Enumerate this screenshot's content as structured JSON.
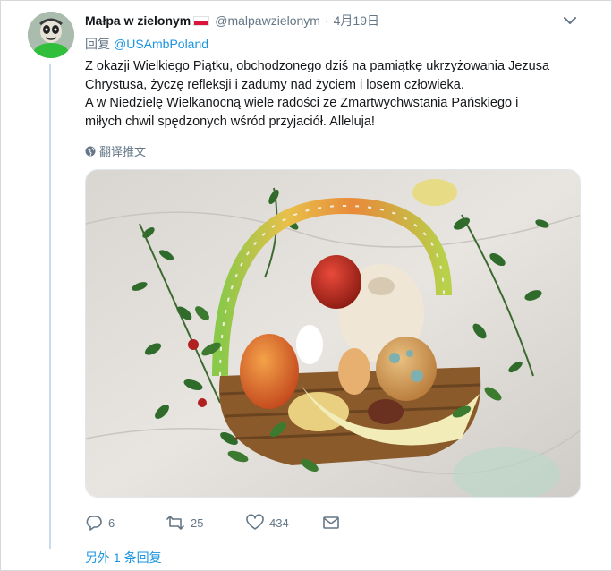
{
  "tweet": {
    "author_name": "Małpa w zielonym",
    "flag": "Poland flag",
    "handle": "@malpawzielonym",
    "separator": "·",
    "date": "4月19日",
    "reply_prefix": "回复",
    "reply_to": "@USAmbPoland",
    "text_lines": [
      "Z okazji Wielkiego Piątku, obchodzonego dziś na pamiątkę ukrzyżowania Jezusa",
      "Chrystusa, życzę refleksji i zadumy nad życiem i losem człowieka.",
      "A w Niedzielę Wielkanocną wiele radości ze Zmartwychwstania Pańskiego i",
      "miłych chwil spędzonych wśród przyjaciół. Alleluja!"
    ],
    "translate_label": "翻译推文",
    "image_description": "Easter basket with eggs, cake and boxwood",
    "actions": {
      "replies": "6",
      "retweets": "25",
      "likes": "434"
    },
    "more_replies": "另外 1 条回复"
  },
  "colors": {
    "link": "#1b95e0",
    "secondary_text": "#657786",
    "thread_line": "#c7dcec",
    "flag_red": "#dc143c"
  },
  "icons": {
    "chevron": "chevron-down-icon",
    "globe": "globe-icon",
    "reply": "reply-icon",
    "retweet": "retweet-icon",
    "like": "heart-icon",
    "dm": "envelope-icon"
  }
}
